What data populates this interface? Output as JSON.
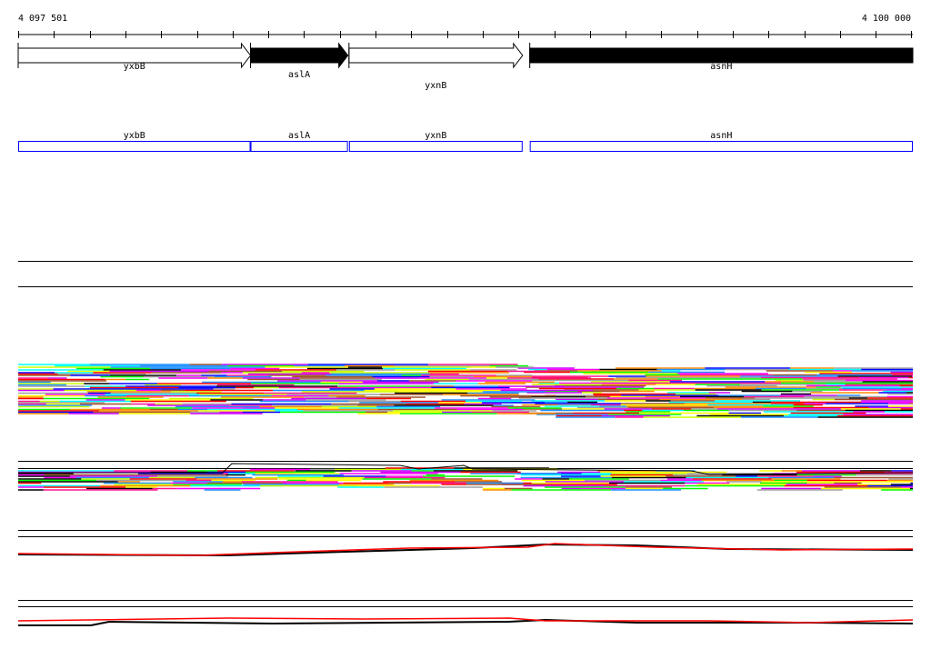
{
  "ruler": {
    "start_label": "4 097 501",
    "end_label": "4 100 000",
    "start": 4097501,
    "end": 4100000
  },
  "genes": [
    {
      "name": "yxbB",
      "start": 4097501,
      "end": 4098150,
      "strand": "+",
      "fill": "#ffffff"
    },
    {
      "name": "aslA",
      "start": 4098150,
      "end": 4098422,
      "strand": "+",
      "fill": "#000000"
    },
    {
      "name": "yxnB",
      "start": 4098425,
      "end": 4098910,
      "strand": "+",
      "fill": "#ffffff"
    },
    {
      "name": "asnH",
      "start": 4098930,
      "end": 4100000,
      "strand": "+",
      "fill": "#000000"
    }
  ],
  "annotation_color": "#0000ff",
  "palette": [
    "#ff0000",
    "#00ff00",
    "#0000ff",
    "#ff00ff",
    "#00ffff",
    "#ff8c00",
    "#a0a0a0",
    "#000000",
    "#c8ff00",
    "#1e90ff",
    "#cc00ff",
    "#ff1493",
    "#a0522d",
    "#ffff00"
  ],
  "profile_colors": {
    "primary": "#000000",
    "secondary": "#ff0000"
  }
}
